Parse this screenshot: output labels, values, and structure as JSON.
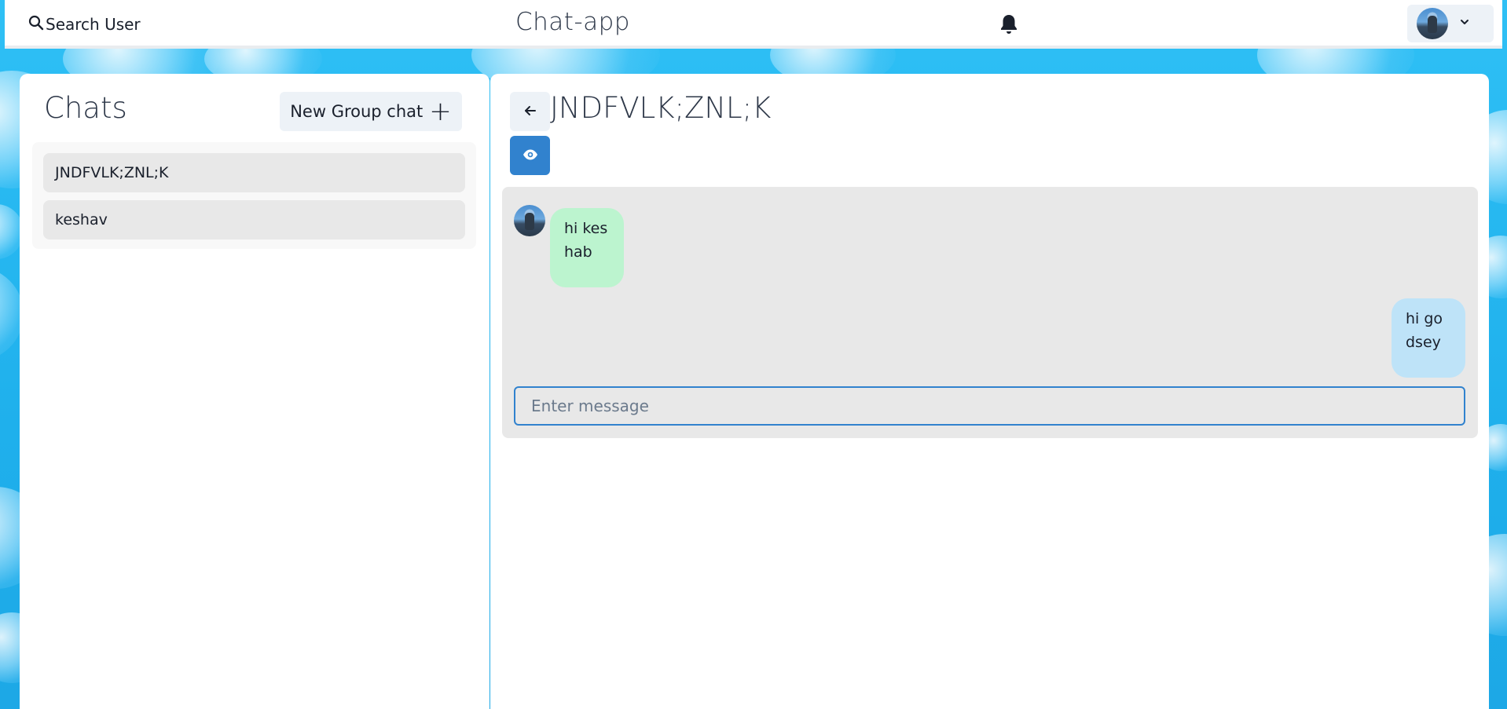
{
  "header": {
    "search_label": "Search User",
    "app_title": "Chat-app",
    "icons": [
      "search-icon",
      "bell-icon",
      "avatar",
      "chevron-down-icon"
    ]
  },
  "sidebar": {
    "title": "Chats",
    "new_group_label": "New Group chat",
    "new_group_icon": "+",
    "chats": [
      {
        "name": "JNDFVLK;ZNL;K"
      },
      {
        "name": "keshav"
      }
    ]
  },
  "chat": {
    "title": "JNDFVLK;ZNL;K",
    "back_icon": "arrow-left-icon",
    "view_icon": "eye-icon",
    "messages": [
      {
        "side": "left",
        "text": "hi keshab"
      },
      {
        "side": "right",
        "text": "hi godsey"
      }
    ],
    "input_placeholder": "Enter message"
  },
  "colors": {
    "accent": "#3182ce",
    "bubble_received": "#bcf4cf",
    "bubble_sent": "#bee3f8",
    "panel_bg": "#e8e8e8"
  }
}
